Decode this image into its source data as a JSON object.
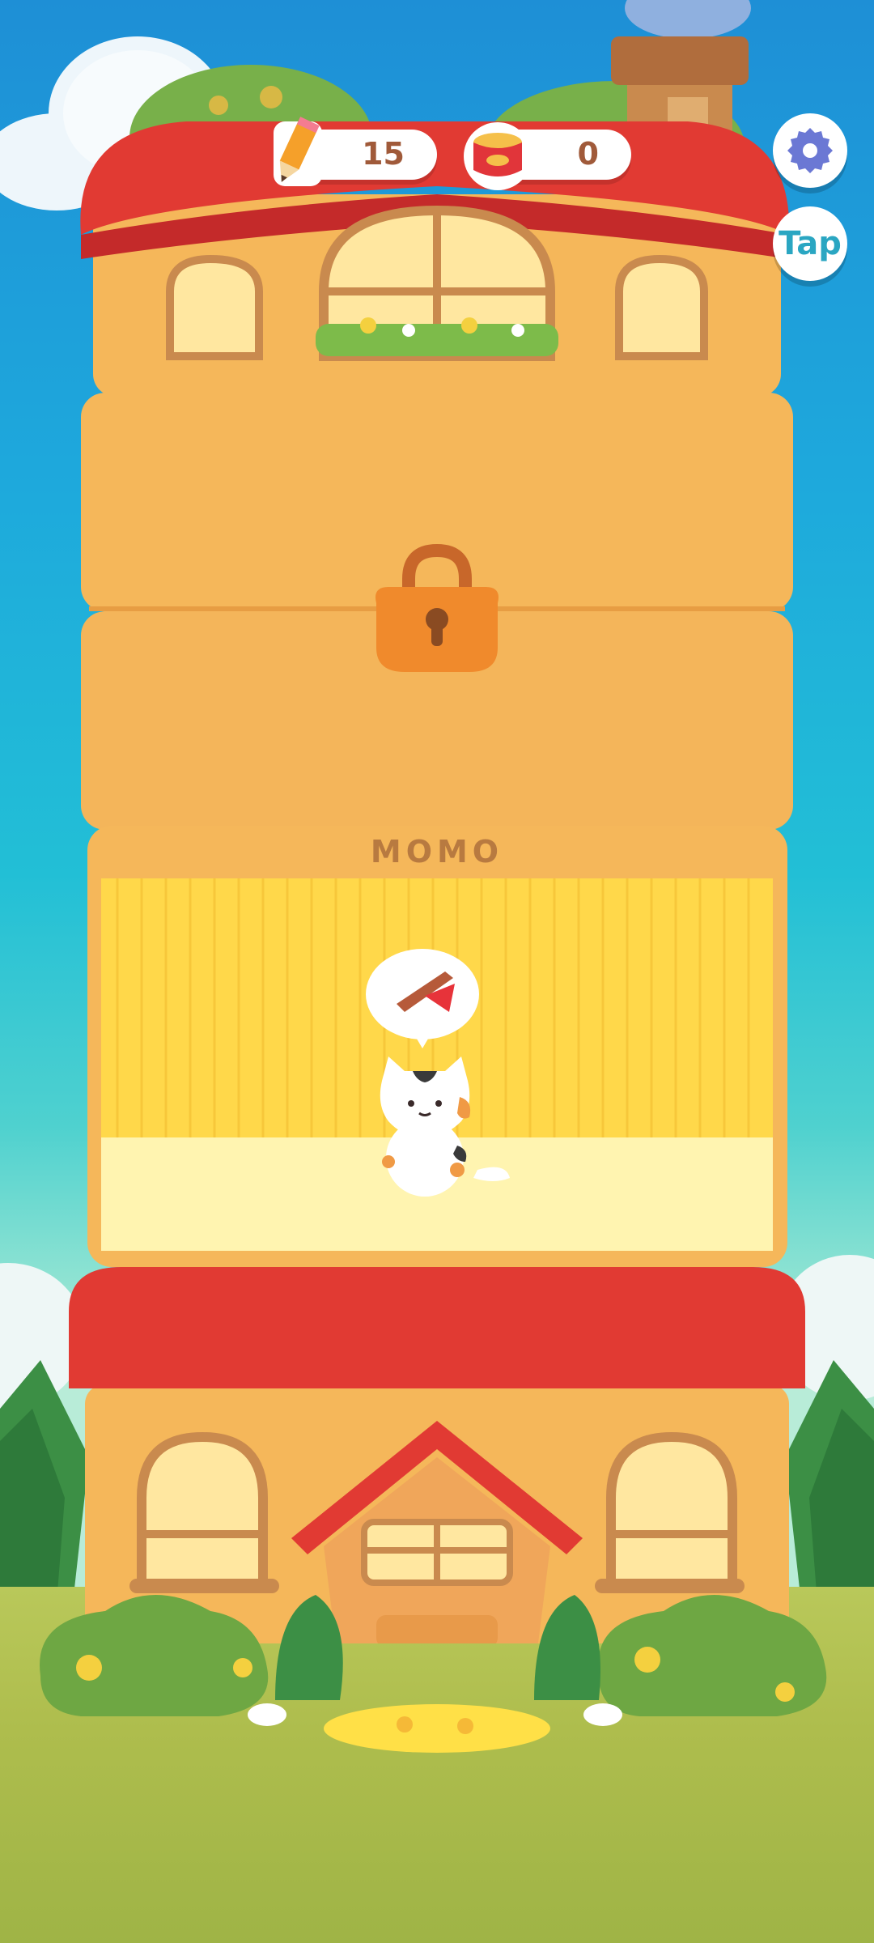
{
  "hud": {
    "pencils": {
      "icon": "pencil-icon",
      "count": "15"
    },
    "cans": {
      "icon": "cat-food-can-icon",
      "count": "0"
    },
    "settings": {
      "icon": "gear-icon"
    },
    "tap_label": "Tap"
  },
  "rooms": {
    "top_floor": {
      "state": "decorated"
    },
    "locked_floor": {
      "icon": "padlock-icon",
      "locked": true
    },
    "momo_room": {
      "name": "MOMO",
      "cat_request_icon": "red-scarf-icon"
    }
  },
  "colors": {
    "roof": "#e13a33",
    "wall": "#f5b75a",
    "room_wallpaper": "#ffd84a",
    "room_floor": "#fff4b0",
    "ui_text": "#a05a3a",
    "tap_text": "#2aa6c2"
  }
}
